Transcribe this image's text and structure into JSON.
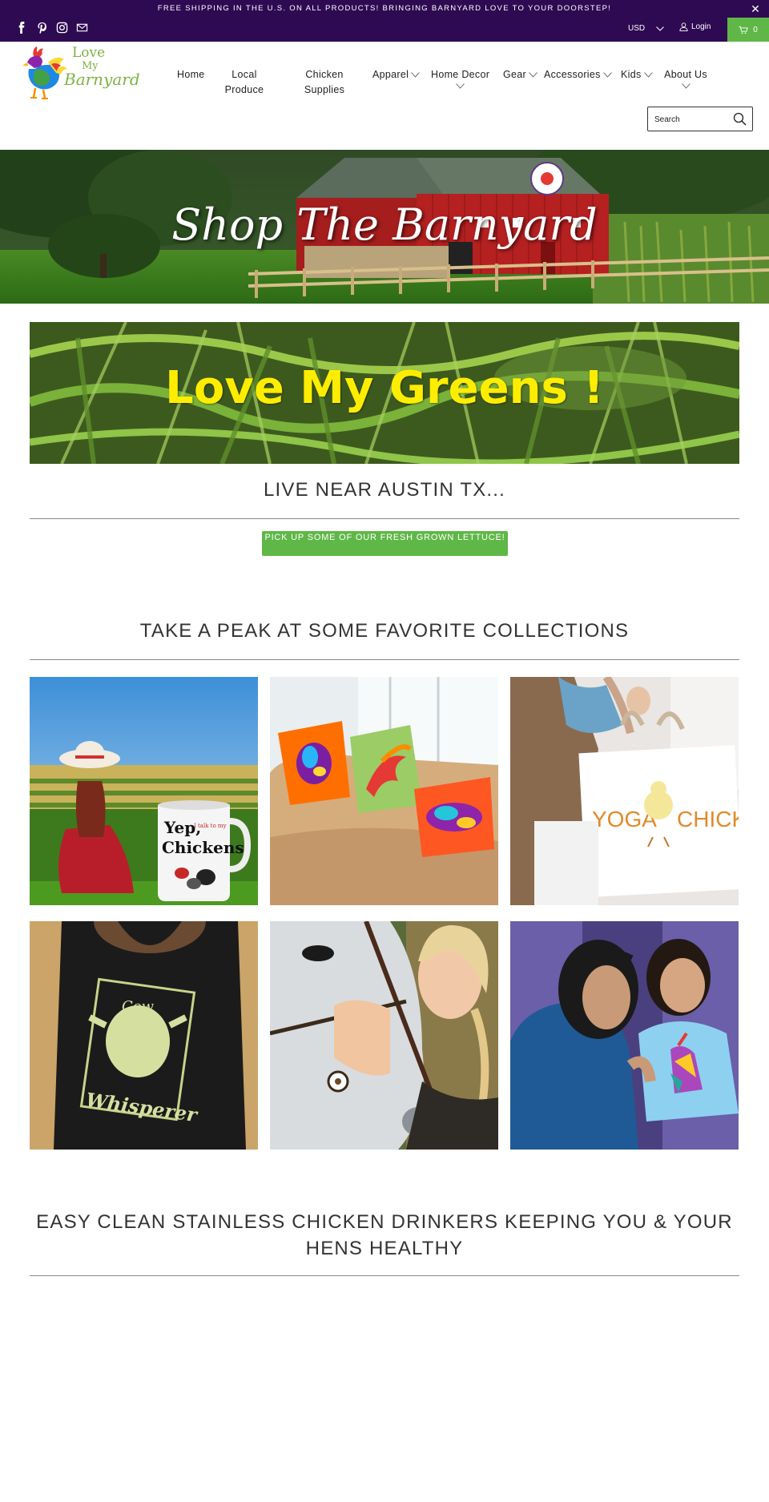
{
  "announcement": {
    "text": "FREE SHIPPING IN THE U.S. ON ALL PRODUCTS!  BRINGING BARNYARD LOVE TO YOUR DOORSTEP!",
    "close_symbol": "✕"
  },
  "social_icons": [
    "facebook-icon",
    "pinterest-icon",
    "instagram-icon",
    "email-icon"
  ],
  "topbar": {
    "currency": "USD",
    "login": "Login",
    "cart_count": "0"
  },
  "logo": {
    "line1": "Love",
    "line2": "My",
    "line3": "Barnyard"
  },
  "nav": {
    "items": [
      {
        "label": "Home"
      },
      {
        "label": "Local Produce"
      },
      {
        "label": "Chicken Supplies"
      },
      {
        "label": "Apparel"
      },
      {
        "label": "Home Decor"
      },
      {
        "label": "Gear"
      },
      {
        "label": "Accessories"
      },
      {
        "label": "Kids"
      },
      {
        "label": "About Us"
      }
    ]
  },
  "search": {
    "placeholder": "Search"
  },
  "hero": {
    "title": "Shop The Barnyard"
  },
  "greens_banner": {
    "title": "Love My Greens !"
  },
  "sections": {
    "austin_heading": "LIVE NEAR AUSTIN TX...",
    "pickup_button": "PICK UP SOME OF OUR FRESH GROWN LETTUCE!",
    "collections_heading": "TAKE A PEAK AT SOME FAVORITE COLLECTIONS",
    "drinkers_heading": "EASY CLEAN STAINLESS CHICKEN DRINKERS KEEPING YOU & YOUR HENS HEALTHY"
  },
  "collection_tiles": [
    {
      "mug_text_1": "Yep,",
      "mug_text_2": "Chickens",
      "mug_text_3": "I talk to my"
    },
    {},
    {
      "bag_text_1": "YOGA",
      "bag_text_2": "CHICK"
    },
    {
      "shirt_text_1": "Cow",
      "shirt_text_2": "Whisperer"
    },
    {},
    {}
  ],
  "colors": {
    "topbar_bg": "#2e0a52",
    "accent_green": "#5fb747",
    "greens_title": "#ffed00"
  }
}
